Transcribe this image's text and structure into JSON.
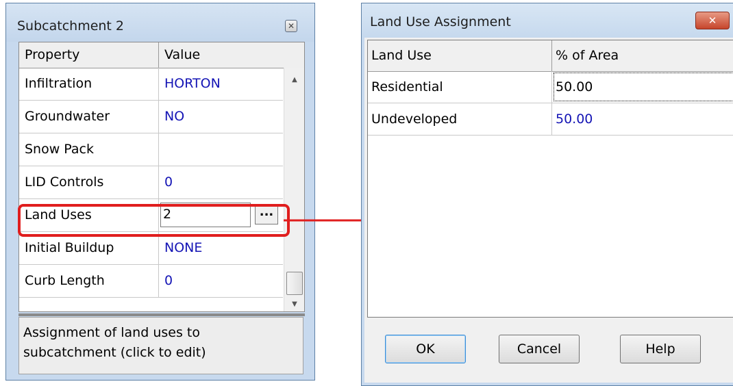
{
  "property_editor": {
    "title": "Subcatchment 2",
    "close_icon": "close-icon",
    "columns": {
      "property": "Property",
      "value": "Value"
    },
    "rows": [
      {
        "property": "Infiltration",
        "value": "HORTON"
      },
      {
        "property": "Groundwater",
        "value": "NO"
      },
      {
        "property": "Snow Pack",
        "value": ""
      },
      {
        "property": "LID Controls",
        "value": "0"
      },
      {
        "property": "Land Uses",
        "value": "2",
        "editing": true,
        "button_label": "..."
      },
      {
        "property": "Initial Buildup",
        "value": "NONE"
      },
      {
        "property": "Curb Length",
        "value": "0"
      }
    ],
    "hint_line1": "Assignment of land uses to",
    "hint_line2": "subcatchment (click to edit)"
  },
  "land_use_dialog": {
    "title": "Land Use Assignment",
    "close_icon": "close-icon",
    "columns": {
      "land_use": "Land Use",
      "percent": "% of Area"
    },
    "rows": [
      {
        "land_use": "Residential",
        "percent": "50.00"
      },
      {
        "land_use": "Undeveloped",
        "percent": "50.00"
      }
    ],
    "buttons": {
      "ok": "OK",
      "cancel": "Cancel",
      "help": "Help"
    }
  },
  "colors": {
    "highlight": "#e01e1e",
    "value_text": "#1515b5",
    "frame": "#c7d9ee",
    "close_button": "#c6452b"
  }
}
